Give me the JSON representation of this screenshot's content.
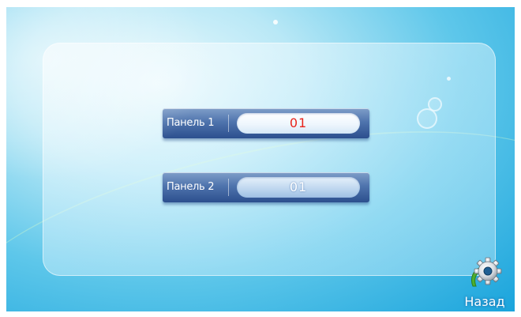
{
  "panels": [
    {
      "label": "Панель 1",
      "value": "01"
    },
    {
      "label": "Панель 2",
      "value": "01"
    }
  ],
  "back_button": {
    "label": "Назад",
    "icon": "gear-icon"
  },
  "colors": {
    "active_value": "#e8231a",
    "inactive_value": "#ffffff",
    "field_blue": "#4f74ad"
  }
}
